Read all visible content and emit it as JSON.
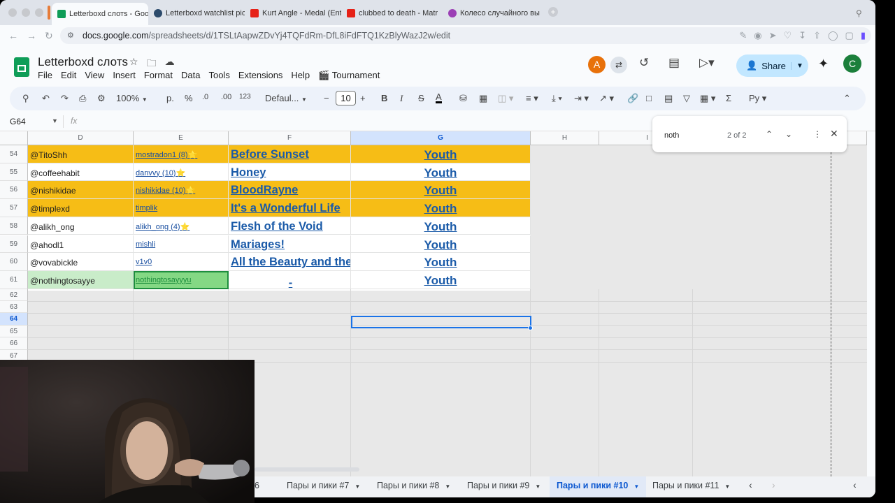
{
  "browser": {
    "tabs": [
      {
        "title": "Letterboxd слотs - Goo",
        "color": "#0f9d58",
        "active": true
      },
      {
        "title": "Letterboxd watchlist pic",
        "color": "#2c4a6b",
        "active": false
      },
      {
        "title": "Kurt Angle - Medal (Ent",
        "color": "#e62117",
        "active": false
      },
      {
        "title": "clubbed to death - Matr",
        "color": "#e62117",
        "active": false
      },
      {
        "title": "Колесо случайного вы",
        "color": "#9b3fb5",
        "active": false
      }
    ],
    "url_domain": "docs.google.com",
    "url_path": "/spreadsheets/d/1TSLtAapwZDvYj4TQFdRm-DfL8iFdFTQ1KzBlyWazJ2w/edit"
  },
  "doc": {
    "title": "Letterboxd слотs",
    "menu": [
      "File",
      "Edit",
      "View",
      "Insert",
      "Format",
      "Data",
      "Tools",
      "Extensions",
      "Help",
      "Tournament"
    ],
    "avatar_a": "A",
    "avatar_c": "C",
    "share_label": "Share"
  },
  "toolbar": {
    "zoom": "100%",
    "currency": "р.",
    "percent": "%",
    "dec_decrease": ".0",
    "dec_increase": ".00",
    "number_format": "123",
    "font": "Defaul...",
    "font_size": "10"
  },
  "formula": {
    "cell_ref": "G64",
    "fx": "fx"
  },
  "find": {
    "query": "noth",
    "count": "2 of 2"
  },
  "columns": [
    "D",
    "E",
    "F",
    "G",
    "H",
    "I"
  ],
  "rows": [
    {
      "num": "54",
      "user": "@TitoShh",
      "link": "mostradon1 (8)⭐",
      "film": "Before Sunset",
      "choice": "Youth",
      "highlight": true
    },
    {
      "num": "55",
      "user": "@coffeehabit",
      "link": "danvvy (10)⭐",
      "film": "Honey",
      "choice": "Youth",
      "highlight": false
    },
    {
      "num": "56",
      "user": "@nishikidae",
      "link": "nishikidae (10)⭐",
      "film": "BloodRayne",
      "choice": "Youth",
      "highlight": true
    },
    {
      "num": "57",
      "user": "@timplexd",
      "link": "timplik",
      "film": "It's a Wonderful Life",
      "choice": "Youth",
      "highlight": true
    },
    {
      "num": "58",
      "user": "@alikh_ong",
      "link": "alikh_ong (4)⭐",
      "film": "Flesh of the Void",
      "choice": "Youth",
      "highlight": false
    },
    {
      "num": "59",
      "user": "@ahodl1",
      "link": "mishli",
      "film": "Mariages!",
      "choice": "Youth",
      "highlight": false
    },
    {
      "num": "60",
      "user": "@vovabickle",
      "link": "v1v0",
      "film": "All the Beauty and the",
      "choice": "Youth",
      "highlight": false
    },
    {
      "num": "61",
      "user": "@nothingtosayye",
      "link": "nothingtosayyyu",
      "film": "-",
      "choice": "Youth",
      "highlight": false,
      "found": true
    }
  ],
  "empty_rows": [
    "62",
    "63",
    "64",
    "65",
    "66",
    "67"
  ],
  "selected_row": "64",
  "selected_col": "G",
  "sheet_tabs": [
    {
      "label": "6",
      "active": false
    },
    {
      "label": "Пары и пики #7",
      "active": false
    },
    {
      "label": "Пары и пики #8",
      "active": false
    },
    {
      "label": "Пары и пики #9",
      "active": false
    },
    {
      "label": "Пары и пики #10",
      "active": true
    },
    {
      "label": "Пары и пики #11",
      "active": false
    }
  ],
  "colors": {
    "highlight_row": "#f6bd16",
    "found_user": "#c9ecc9",
    "found_link": "#84d884",
    "link_blue": "#1a5aa8",
    "accent": "#1a73e8"
  }
}
